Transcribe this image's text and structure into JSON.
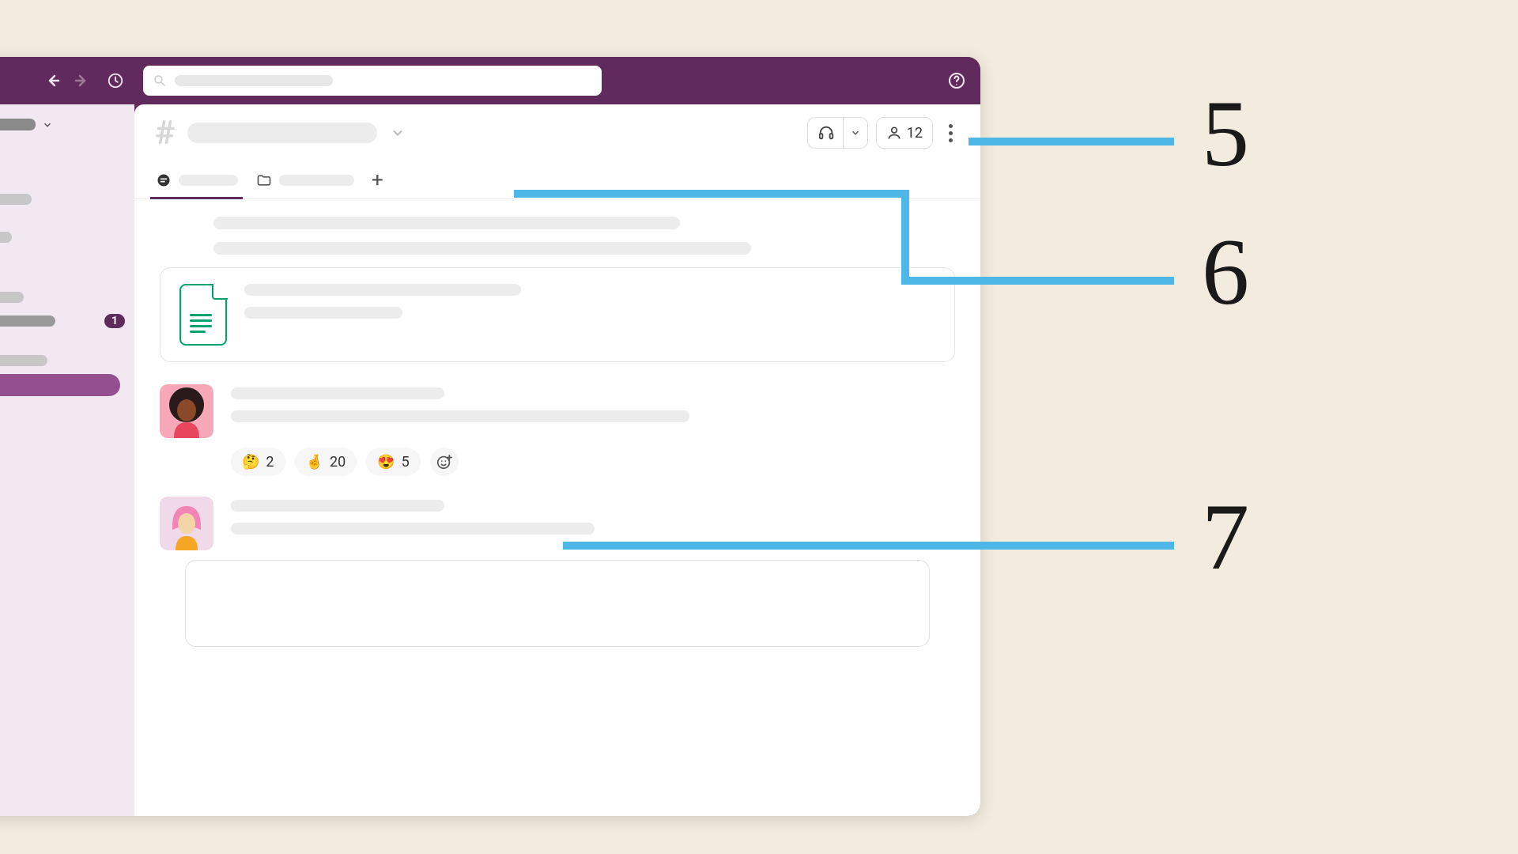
{
  "sidebar": {
    "badge_count": "1"
  },
  "header": {
    "member_count": "12"
  },
  "reactions": [
    {
      "emoji": "🤔",
      "count": "2"
    },
    {
      "emoji": "🤞",
      "count": "20"
    },
    {
      "emoji": "😍",
      "count": "5"
    }
  ],
  "callouts": {
    "five": "5",
    "six": "6",
    "seven": "7"
  },
  "colors": {
    "brand": "#602a5c",
    "accent_line": "#4db8e8",
    "file_green": "#00a36c"
  }
}
